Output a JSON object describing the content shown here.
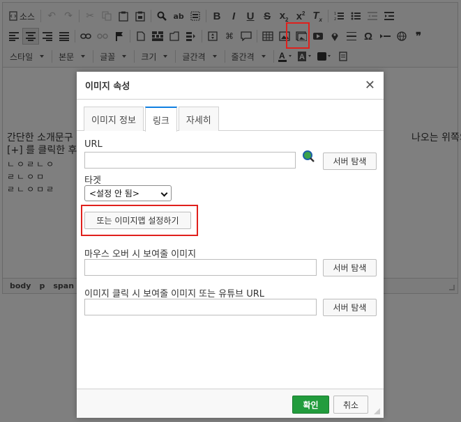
{
  "toolbar": {
    "source_label": "소스",
    "style_combo": "스타일",
    "format_combo": "본문",
    "font_combo": "글꼴",
    "size_combo": "크기",
    "letter_spacing_combo": "글간격",
    "line_height_combo": "줄간격",
    "bold": "B",
    "italic": "I",
    "underline": "U",
    "strike": "S",
    "omega": "Ω",
    "quote": "❞"
  },
  "content": {
    "line1": "간단한 소개문구",
    "line1_tail": "나오는 위쪽의",
    "line2": "[+] 를 클릭한 후",
    "line3": "ㄴㅇㄹㄴㅇ",
    "line4": "ㄹㄴㅇㅁ",
    "line5": "ㄹㄴㅇㅁㄹ"
  },
  "path_bar": [
    "body",
    "p",
    "span"
  ],
  "dialog": {
    "title": "이미지 속성",
    "close": "✕",
    "tabs": [
      {
        "label": "이미지 정보",
        "active": false
      },
      {
        "label": "링크",
        "active": true
      },
      {
        "label": "자세히",
        "active": false
      }
    ],
    "url_label": "URL",
    "url_value": "",
    "browse_server": "서버 탐색",
    "target_label": "타겟",
    "target_value": "<설정 안 됨>",
    "imagemap_button": "또는 이미지맵 설정하기",
    "mouseover_label": "마우스 오버 시 보여줄 이미지",
    "mouseover_value": "",
    "click_label": "이미지 클릭 시 보여줄 이미지 또는 유튜브 URL",
    "click_value": "",
    "ok": "확인",
    "cancel": "취소"
  },
  "colors": {
    "highlight": "#e0201c",
    "ok_button": "#229c3d",
    "active_tab_border": "#0e7fe1"
  }
}
